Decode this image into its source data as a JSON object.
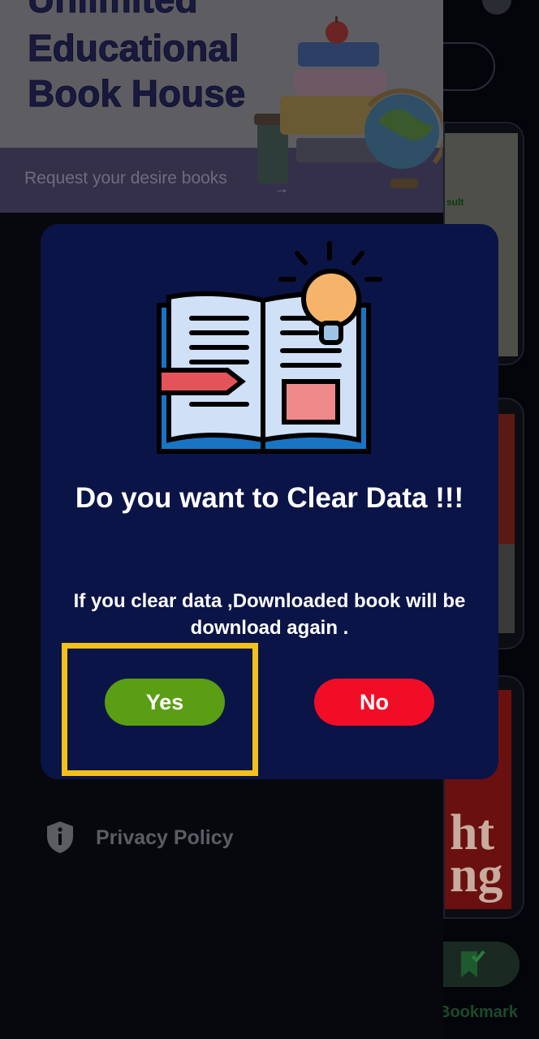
{
  "banner": {
    "line0": "Unlimited",
    "line1": "Educational",
    "line2": "Book House",
    "subtitle": "Request your desire books",
    "arrow": "→"
  },
  "drawer": {
    "privacy_label": "Privacy Policy",
    "privacy_icon": "shield-info-icon"
  },
  "right_panel": {
    "card1_text": "sult",
    "card3_text": "ht\nng",
    "bookmark_label": "Bookmark",
    "bookmark_icon": "bookmark-check-icon"
  },
  "dialog": {
    "illustration": "open-book-lightbulb-icon",
    "title": "Do you want to Clear Data !!!",
    "message": "If you clear data ,Downloaded book will be download again .",
    "yes_label": "Yes",
    "no_label": "No"
  },
  "colors": {
    "dialog_bg": "#0b1447",
    "yes_button": "#5a9e14",
    "no_button": "#f20d26",
    "highlight": "#f3c11c"
  }
}
